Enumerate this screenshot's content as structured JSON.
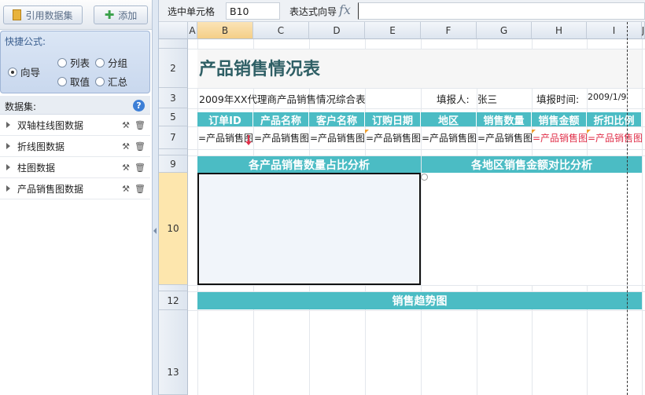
{
  "toolbar": {
    "ref_dataset_label": "引用数据集",
    "add_label": "添加"
  },
  "quick_formula": {
    "title": "快捷公式:",
    "options": [
      {
        "label": "向导",
        "selected": true
      },
      {
        "label": "列表",
        "selected": false
      },
      {
        "label": "分组",
        "selected": false
      },
      {
        "label": "取值",
        "selected": false
      },
      {
        "label": "汇总",
        "selected": false
      }
    ]
  },
  "datasets": {
    "title": "数据集:",
    "items": [
      "双轴柱线图数据",
      "折线图数据",
      "柱图数据",
      "产品销售图数据"
    ]
  },
  "formula_bar": {
    "selected_cell_label": "选中单元格",
    "selected_cell": "B10",
    "expr_wizard_label": "表达式向导",
    "fx": "fx",
    "expression": ""
  },
  "columns": [
    "A",
    "B",
    "C",
    "D",
    "E",
    "F",
    "G",
    "H",
    "I",
    "J"
  ],
  "rows": [
    "2",
    "3",
    "5",
    "7",
    "9",
    "10",
    "12",
    "13"
  ],
  "sheet": {
    "title": "产品销售情况表",
    "subtitle": "2009年XX代理商产品销售情况综合表",
    "filler_label": "填报人:",
    "filler": "张三",
    "report_time_label": "填报时间:",
    "report_time": "2009/1/9",
    "header_cells": [
      "订单ID",
      "产品名称",
      "客户名称",
      "订购日期",
      "地区",
      "销售数量",
      "销售金额",
      "折扣比例"
    ],
    "data_cells": [
      "=产品销售图",
      "=产品销售图",
      "=产品销售图",
      "=产品销售图",
      "=产品销售图",
      "=产品销售图",
      "=产品销售图",
      "=产品销售图"
    ],
    "section_left": "各产品销售数量占比分析",
    "section_right": "各地区销售金额对比分析",
    "section_trend": "销售趋势图"
  },
  "colors": {
    "teal": "#4bbcc4",
    "title": "#2f5f65",
    "red_formula": "#e0304a",
    "selection": "#fde6ad"
  }
}
